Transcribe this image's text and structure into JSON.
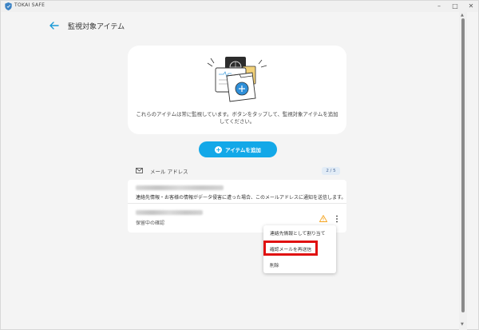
{
  "window": {
    "title": "TOKAI SAFE",
    "controls": {
      "minimize": "–",
      "maximize": "□",
      "close": "✕"
    }
  },
  "header": {
    "title": "監視対象アイテム",
    "back_icon": "arrow-left-icon"
  },
  "hero": {
    "message": "これらのアイテムは常に監視しています。ボタンをタップして、監視対象アイテムを追加してください。"
  },
  "add_button": {
    "label": "アイテムを追加",
    "icon": "plus-circle-icon"
  },
  "colors": {
    "accent": "#13a8e8",
    "warning": "#f5a623",
    "highlight": "#e01010"
  },
  "email_section": {
    "title": "メール アドレス",
    "count": "2 / 5",
    "items": [
      {
        "description": "連絡先情報・お客様の情報がデータ侵害に遭った場合、このメールアドレスに通知を送信します。"
      },
      {
        "status": "保留中の確認"
      }
    ]
  },
  "context_menu": {
    "items": [
      {
        "label": "連絡先情報として割り当て"
      },
      {
        "label": "確認メールを再送信"
      },
      {
        "label": "削除"
      }
    ]
  }
}
